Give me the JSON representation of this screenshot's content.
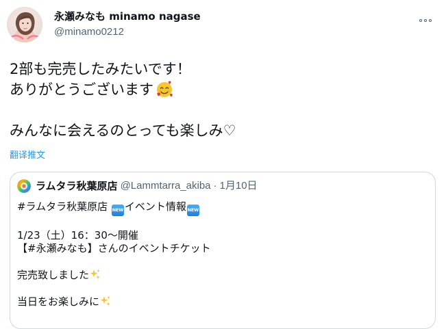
{
  "tweet": {
    "author": {
      "display_name": "永瀬みなも minamo nagase",
      "handle": "@minamo0212",
      "avatar_icon": "profile-photo"
    },
    "text_lines": [
      "2部も完売したみたいです！",
      "ありがとうございます",
      "",
      "みんなに会えるのとっても楽しみ♡"
    ],
    "smile_emoji": "smiling-face-with-hearts",
    "translate_label": "翻译推文",
    "more_icon": "more-icon"
  },
  "quoted_tweet": {
    "author": {
      "display_name": "ラムタラ秋葉原店",
      "handle": "@Lammtarra_akiba",
      "separator": "·",
      "date": "1月10日",
      "avatar_icon": "shop-logo"
    },
    "lines": [
      {
        "before": "#ラムタラ秋葉原店 ",
        "badge": "NEW",
        "middle": "イベント情報",
        "badge2": "NEW"
      },
      {
        "text": ""
      },
      {
        "text": "1/23（土）16：30～開催"
      },
      {
        "text": "【#永瀬みなも】さんのイベントチケット"
      },
      {
        "text": ""
      },
      {
        "text": "完売致しました",
        "emoji": "sparkles"
      },
      {
        "text": ""
      },
      {
        "text": "当日をお楽しみに",
        "emoji": "sparkles"
      }
    ]
  },
  "colors": {
    "text": "#0f1419",
    "secondary": "#536471",
    "link": "#1d9bf0",
    "border": "#cfd9de",
    "new_badge": "#2a8ef0"
  }
}
